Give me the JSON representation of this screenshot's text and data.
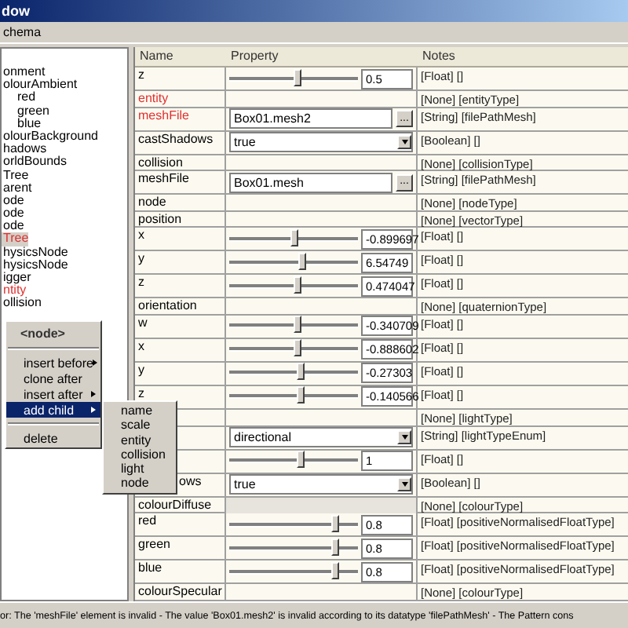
{
  "window": {
    "title": "dow"
  },
  "menu_bar": [
    "chema"
  ],
  "tree": [
    {
      "label": "onment",
      "invalid": false,
      "selected": false
    },
    {
      "label": "olourAmbient",
      "invalid": false,
      "selected": false,
      "children": [
        {
          "label": "red",
          "invalid": false,
          "selected": false
        },
        {
          "label": "green",
          "invalid": false,
          "selected": false
        },
        {
          "label": "blue",
          "invalid": false,
          "selected": false
        }
      ]
    },
    {
      "label": "olourBackground",
      "invalid": false,
      "selected": false
    },
    {
      "label": "hadows",
      "invalid": false,
      "selected": false
    },
    {
      "label": "orldBounds",
      "invalid": false,
      "selected": false
    },
    {
      "label": "Tree",
      "invalid": false,
      "selected": false
    },
    {
      "label": "arent",
      "invalid": false,
      "selected": false
    },
    {
      "label": "ode",
      "invalid": false,
      "selected": false
    },
    {
      "label": "ode",
      "invalid": false,
      "selected": false
    },
    {
      "label": "ode",
      "invalid": false,
      "selected": false
    },
    {
      "label": "Tree",
      "invalid": true,
      "selected": true
    },
    {
      "label": "hysicsNode",
      "invalid": false,
      "selected": false
    },
    {
      "label": "hysicsNode",
      "invalid": false,
      "selected": false
    },
    {
      "label": "igger",
      "invalid": false,
      "selected": false
    },
    {
      "label": "ntity",
      "invalid": true,
      "selected": false
    },
    {
      "label": "ollision",
      "invalid": false,
      "selected": false
    }
  ],
  "table": {
    "columns": [
      "Name",
      "Property",
      "Notes"
    ],
    "rows": [
      {
        "name": "z",
        "invalid": false,
        "kind": "slider",
        "level": 0.53,
        "value": "0.5",
        "notes": "[Float] []"
      },
      {
        "name": "entity",
        "invalid": true,
        "kind": "none",
        "notes": "[None] [entityType]"
      },
      {
        "name": "meshFile",
        "invalid": true,
        "kind": "text",
        "value": "Box01.mesh2",
        "button": "...",
        "notes": "[String] [filePathMesh]"
      },
      {
        "name": "castShadows",
        "invalid": false,
        "kind": "dropdown",
        "value": "true",
        "notes": "[Boolean] []"
      },
      {
        "name": "collision",
        "invalid": false,
        "kind": "none",
        "notes": "[None] [collisionType]"
      },
      {
        "name": "meshFile",
        "invalid": false,
        "kind": "text",
        "value": "Box01.mesh",
        "button": "...",
        "notes": "[String] [filePathMesh]"
      },
      {
        "name": "node",
        "invalid": false,
        "kind": "none",
        "notes": "[None] [nodeType]"
      },
      {
        "name": "position",
        "invalid": false,
        "kind": "none",
        "notes": "[None] [vectorType]"
      },
      {
        "name": "x",
        "invalid": false,
        "kind": "slider",
        "level": 0.5,
        "value": "-0.899697",
        "notes": "[Float] []"
      },
      {
        "name": "y",
        "invalid": false,
        "kind": "slider",
        "level": 0.56,
        "value": "6.54749",
        "notes": "[Float] []"
      },
      {
        "name": "z",
        "invalid": false,
        "kind": "slider",
        "level": 0.52,
        "value": "0.474047",
        "notes": "[Float] []"
      },
      {
        "name": "orientation",
        "invalid": false,
        "kind": "none",
        "notes": "[None] [quaternionType]"
      },
      {
        "name": "w",
        "invalid": false,
        "kind": "slider",
        "level": 0.52,
        "value": "-0.340709",
        "notes": "[Float] []"
      },
      {
        "name": "x",
        "invalid": false,
        "kind": "slider",
        "level": 0.52,
        "value": "-0.888602",
        "notes": "[Float] []"
      },
      {
        "name": "y",
        "invalid": false,
        "kind": "slider",
        "level": 0.55,
        "value": "-0.27303",
        "notes": "[Float] []"
      },
      {
        "name": "z",
        "invalid": false,
        "kind": "slider",
        "level": 0.55,
        "value": "-0.140566",
        "notes": "[Float] []"
      },
      {
        "kind": "none",
        "notes": "[None] [lightType]"
      },
      {
        "kind": "dropdown",
        "value": "directional",
        "notes": "[String] [lightTypeEnum]"
      },
      {
        "kind": "slider",
        "level": 0.55,
        "value": "1",
        "notes": "[Float] []"
      },
      {
        "name": "ows",
        "partial": true,
        "invalid": false,
        "kind": "dropdown",
        "value": "true",
        "notes": "[Boolean] []"
      },
      {
        "name": "colourDiffuse",
        "invalid": false,
        "kind": "shaded",
        "notes": "[None] [colourType]"
      },
      {
        "name": "red",
        "invalid": false,
        "kind": "slider",
        "level": 0.82,
        "value": "0.8",
        "notes": "[Float] [positiveNormalisedFloatType]"
      },
      {
        "name": "green",
        "invalid": false,
        "kind": "slider",
        "level": 0.82,
        "value": "0.8",
        "notes": "[Float] [positiveNormalisedFloatType]"
      },
      {
        "name": "blue",
        "invalid": false,
        "kind": "slider",
        "level": 0.82,
        "value": "0.8",
        "notes": "[Float] [positiveNormalisedFloatType]"
      },
      {
        "name": "colourSpecular",
        "invalid": false,
        "kind": "none",
        "notes": "[None] [colourType]"
      }
    ]
  },
  "context_menu": {
    "items": [
      {
        "kind": "title",
        "label": "<node>"
      },
      {
        "kind": "separator"
      },
      {
        "kind": "item",
        "label": "insert before",
        "submenu": true,
        "selected": false
      },
      {
        "kind": "item",
        "label": "clone after",
        "submenu": false,
        "selected": false
      },
      {
        "kind": "item",
        "label": "insert after",
        "submenu": true,
        "selected": false
      },
      {
        "kind": "item",
        "label": "add child",
        "submenu": true,
        "selected": true
      },
      {
        "kind": "separator"
      },
      {
        "kind": "item",
        "label": "delete",
        "submenu": false,
        "selected": false
      }
    ],
    "submenu": [
      "name",
      "scale",
      "entity",
      "collision",
      "light",
      "node"
    ]
  },
  "status_bar": "or: The 'meshFile' element is invalid - The value 'Box01.mesh2' is invalid according to its datatype 'filePathMesh' - The Pattern cons"
}
